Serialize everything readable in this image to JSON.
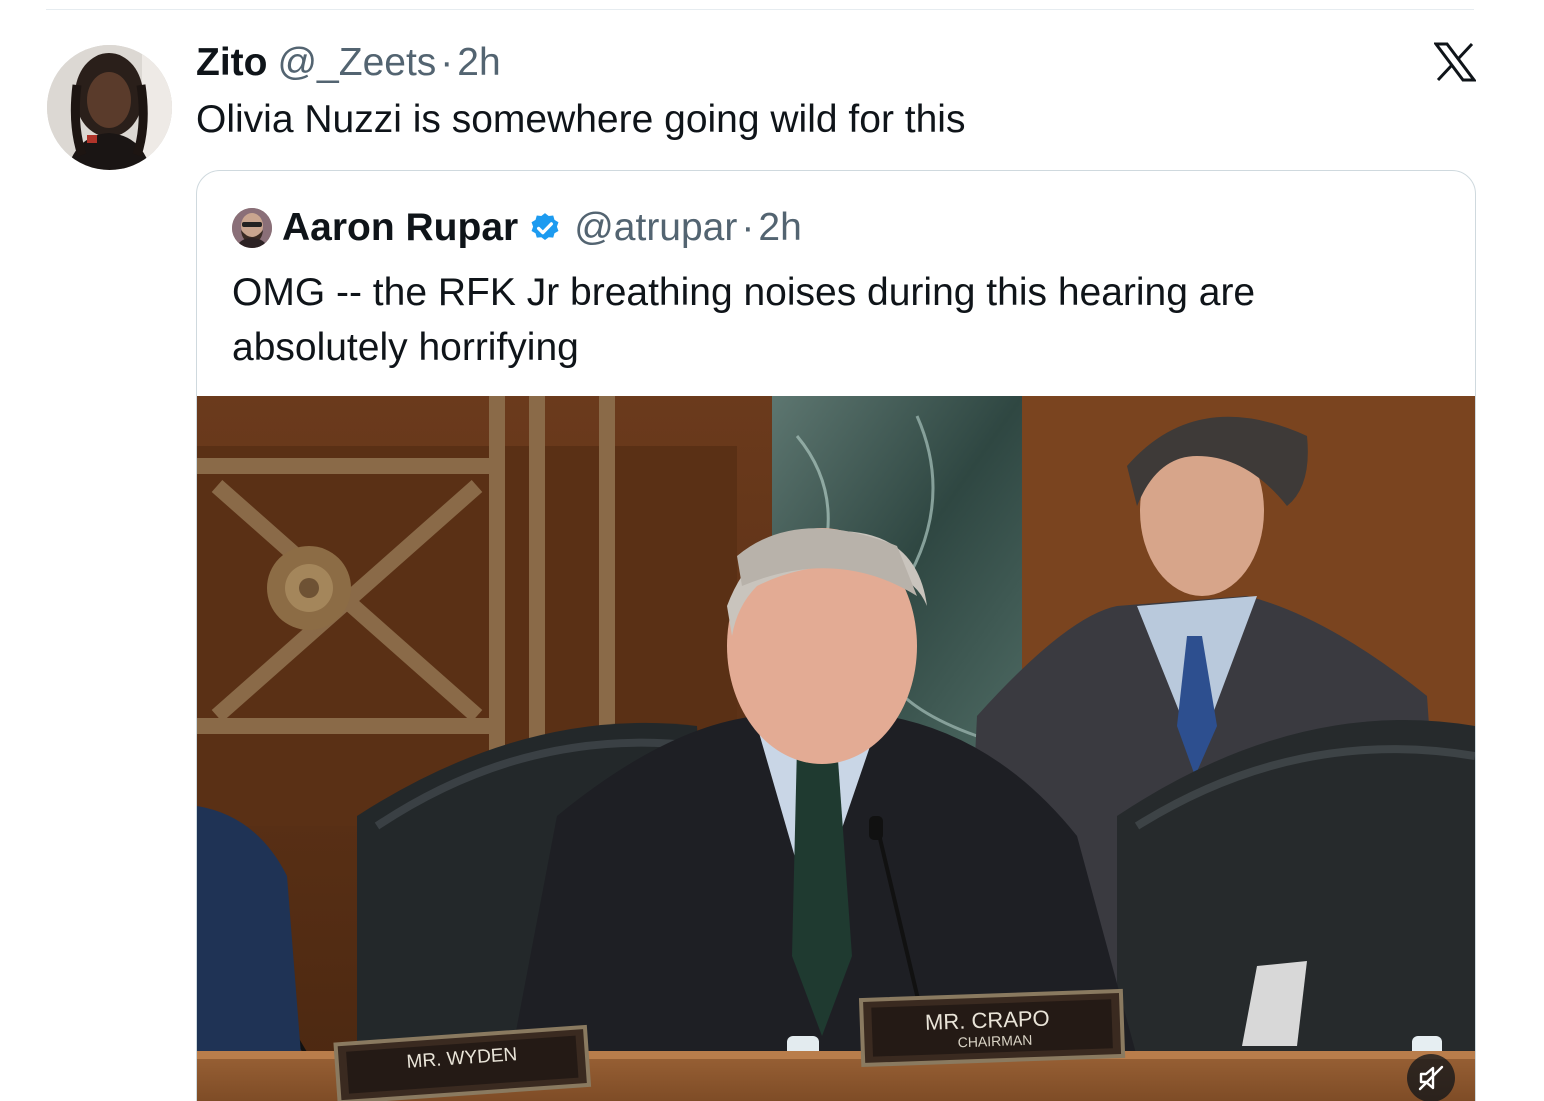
{
  "tweet": {
    "author_name": "Zito",
    "author_handle": "@_Zeets",
    "separator": "·",
    "time": "2h",
    "text": "Olivia Nuzzi is somewhere going wild for this"
  },
  "quoted_tweet": {
    "author_name": "Aaron Rupar",
    "verified": true,
    "author_handle": "@atrupar",
    "separator": "·",
    "time": "2h",
    "text": "OMG -- the RFK Jr breathing noises during this hearing are absolutely horrifying",
    "video": {
      "nameplate_center_name": "MR. CRAPO",
      "nameplate_center_title": "CHAIRMAN",
      "nameplate_left_name": "MR. WYDEN",
      "muted": true
    }
  },
  "icons": {
    "brand": "x-logo-icon",
    "verified": "verified-badge-icon",
    "mute": "sound-off-icon"
  },
  "colors": {
    "text_primary": "#0f1419",
    "text_secondary": "#536471",
    "verified_blue": "#1d9bf0",
    "border": "#cfd9de"
  }
}
